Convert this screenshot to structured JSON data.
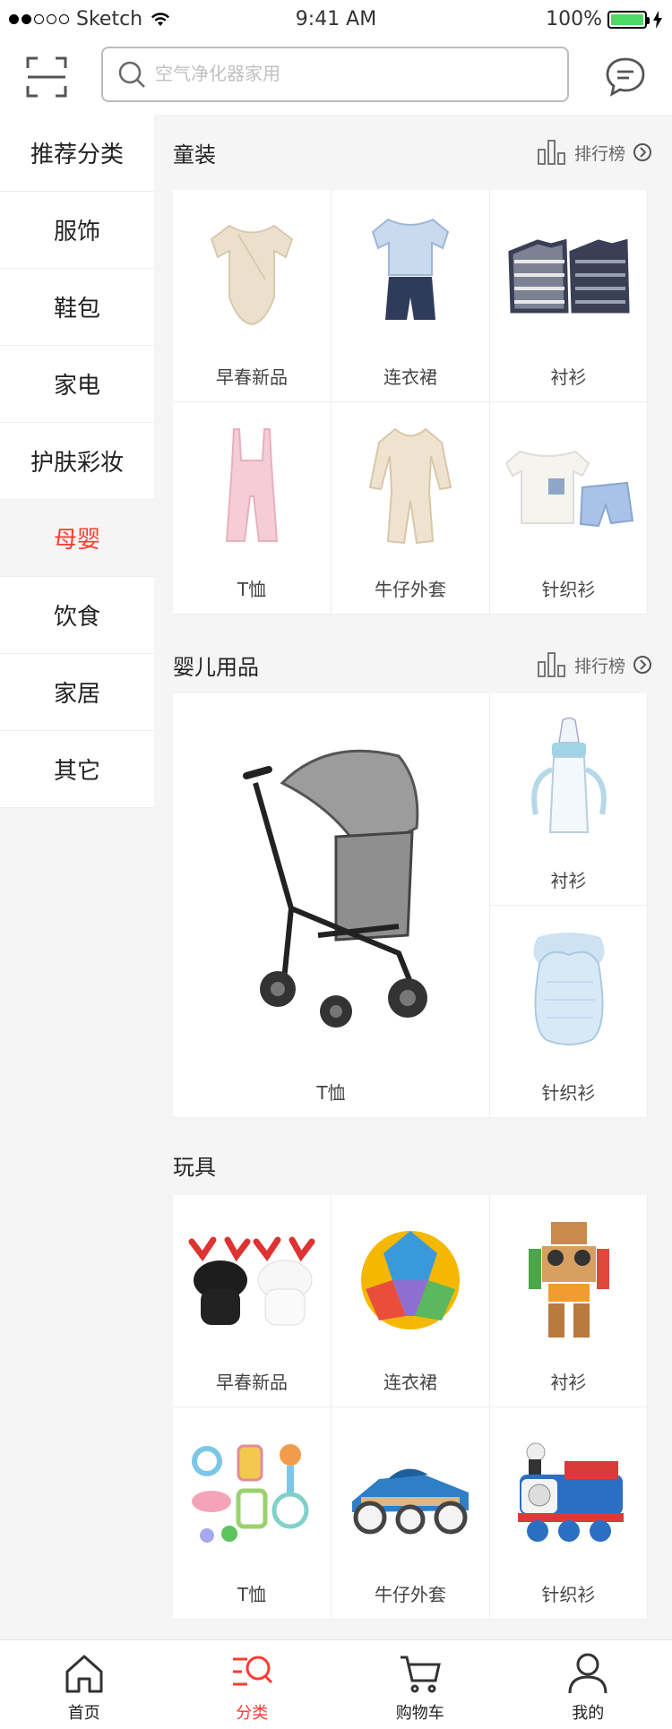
{
  "status": {
    "carrier": "Sketch",
    "time": "9:41 AM",
    "battery": "100%"
  },
  "search": {
    "placeholder": "空气净化器家用"
  },
  "sidebar": {
    "items": [
      {
        "label": "推荐分类"
      },
      {
        "label": "服饰"
      },
      {
        "label": "鞋包"
      },
      {
        "label": "家电"
      },
      {
        "label": "护肤彩妆"
      },
      {
        "label": "母婴"
      },
      {
        "label": "饮食"
      },
      {
        "label": "家居"
      },
      {
        "label": "其它"
      }
    ],
    "active": "母婴"
  },
  "sections": {
    "kids": {
      "title": "童装",
      "rank": "排行榜",
      "items": [
        {
          "label": "早春新品",
          "icon": "onesie-image"
        },
        {
          "label": "连衣裙",
          "icon": "shirt-shorts-image"
        },
        {
          "label": "衬衫",
          "icon": "striped-sweaters-image"
        },
        {
          "label": "T恤",
          "icon": "pink-overalls-image"
        },
        {
          "label": "牛仔外套",
          "icon": "romper-image"
        },
        {
          "label": "针织衫",
          "icon": "tee-shorts-image"
        }
      ]
    },
    "baby": {
      "title": "婴儿用品",
      "rank": "排行榜",
      "items": [
        {
          "label": "T恤",
          "icon": "stroller-image"
        },
        {
          "label": "衬衫",
          "icon": "baby-bottle-image"
        },
        {
          "label": "针织衫",
          "icon": "bib-image"
        }
      ]
    },
    "toys": {
      "title": "玩具",
      "items": [
        {
          "label": "早春新品",
          "icon": "plush-moose-image"
        },
        {
          "label": "连衣裙",
          "icon": "soft-ball-image"
        },
        {
          "label": "衬衫",
          "icon": "wooden-robot-image"
        },
        {
          "label": "T恤",
          "icon": "rattle-set-image"
        },
        {
          "label": "牛仔外套",
          "icon": "toy-car-image"
        },
        {
          "label": "针织衫",
          "icon": "toy-train-image"
        }
      ]
    }
  },
  "tabbar": {
    "items": [
      {
        "label": "首页",
        "icon": "home-icon"
      },
      {
        "label": "分类",
        "icon": "category-icon"
      },
      {
        "label": "购物车",
        "icon": "cart-icon"
      },
      {
        "label": "我的",
        "icon": "profile-icon"
      }
    ],
    "active": "分类"
  },
  "colors": {
    "accent": "#ff3b30",
    "battery": "#4cd964"
  }
}
